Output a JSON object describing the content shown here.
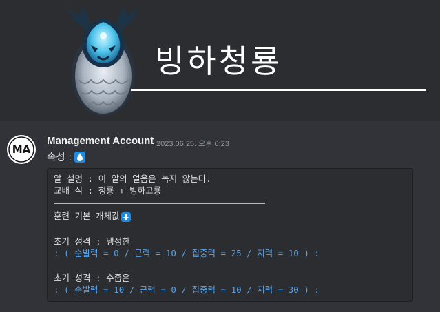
{
  "banner": {
    "title": "빙하청룡"
  },
  "message": {
    "author": "Management Account",
    "timestamp": "2023.06.25. 오후 6:23",
    "avatar_text": "MA",
    "attribute_label": "속성 :",
    "attribute_icon": "water-drop-icon"
  },
  "code": {
    "line1": "알 설명 : 이 알의 얼음은 녹지 않는다.",
    "line2": "교배 식 : 청룡 + 빙하고룡",
    "line3": "훈련 기본 개체값",
    "line3_icon": "arrow-down-icon",
    "line4": "초기 성격 : 냉정한",
    "line5": ": ( 순발력 = 0 / 근력 = 10 / 집중력 = 25 / 지력 = 10 ) :",
    "line6": "초기 성격 : 수줍은",
    "line7": ": ( 순발력 = 10 / 근력 = 0 / 집중력 = 10 / 지력 = 30 ) :"
  },
  "colors": {
    "background": "#313338",
    "code_background": "#2b2d31",
    "highlight": "#5aa2e6",
    "emoji_blue": "#1f8ce3"
  }
}
